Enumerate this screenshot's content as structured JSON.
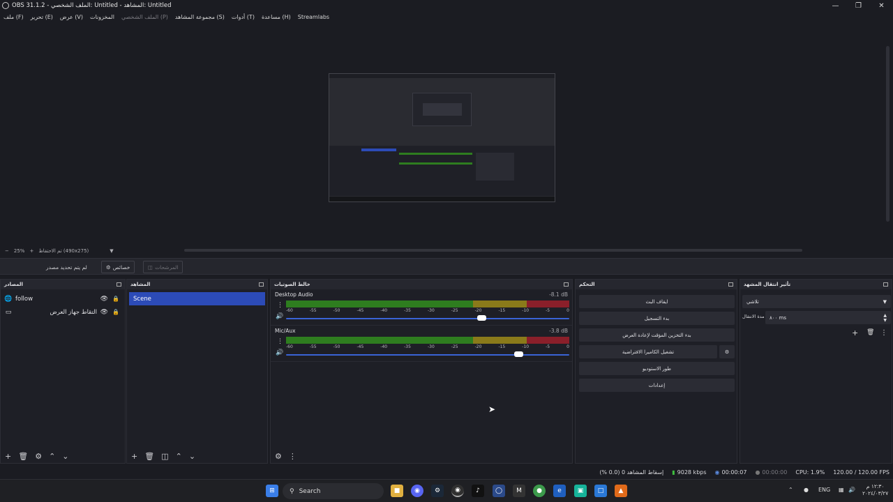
{
  "window": {
    "title": "OBS 31.1.2 - الملف الشخصي: Untitled - المشاهد: Untitled"
  },
  "menu": [
    "ملف (F)",
    "تحرير (E)",
    "عرض (V)",
    "المخزونات",
    "الملف الشخصي (P)",
    "مجموعة المشاهد (S)",
    "أدوات (T)",
    "مساعدة (H)",
    "Streamlabs"
  ],
  "zoom": {
    "level": "25%",
    "canvas": "تم الاحتفاظ (490x275)"
  },
  "source_toolbar": {
    "no_source": "لم يتم تحديد مصدر",
    "properties": "خصائص",
    "filters": "المرشحات"
  },
  "docks": {
    "sources": {
      "title": "المصادر",
      "items": [
        {
          "name": "follow"
        },
        {
          "name": "التقاط جهاز العرض"
        }
      ]
    },
    "scenes": {
      "title": "المشاهد",
      "items": [
        {
          "name": "Scene"
        }
      ]
    },
    "mixer": {
      "title": "خالط الصوتيات",
      "channels": [
        {
          "name": "Desktop Audio",
          "db": "-8.1 dB",
          "volume": 0.69
        },
        {
          "name": "Mic/Aux",
          "db": "-3.8 dB",
          "volume": 0.82
        }
      ],
      "ticks": [
        "-60",
        "-55",
        "-50",
        "-45",
        "-40",
        "-35",
        "-30",
        "-25",
        "-20",
        "-15",
        "-10",
        "-5",
        "0"
      ]
    },
    "controls": {
      "title": "التحكم",
      "buttons": [
        "ايقاف البث",
        "بدء التسجيل",
        "بدء التخزين المؤقت لإعادة العرض",
        "تشغيل الكاميرا الافتراضية",
        "طور الاستوديو",
        "إعدادات"
      ]
    },
    "transitions": {
      "title": "تأثير انتقال المشهد",
      "type": "تلاشي",
      "duration_label": "مدة الانتقال",
      "duration_value": "٨٠٠ ms"
    }
  },
  "status": {
    "dropped": "إسقاط المشاهد 0 (0.0 %)",
    "bitrate": "9028 kbps",
    "stream_time": "00:00:07",
    "rec_time": "00:00:00",
    "cpu": "CPU: 1.9%",
    "fps": "120.00 / 120.00 FPS"
  },
  "taskbar": {
    "search": "Search",
    "lang": "ENG",
    "time": "١٢:٣٠ م",
    "date": "٢٠٢٤/٠٣/٢٧"
  },
  "colors": {
    "accent": "#2c4bb7",
    "meter_green": "#2e7d1f",
    "meter_yellow": "#8a7a1a",
    "meter_red": "#8a1f2a"
  }
}
